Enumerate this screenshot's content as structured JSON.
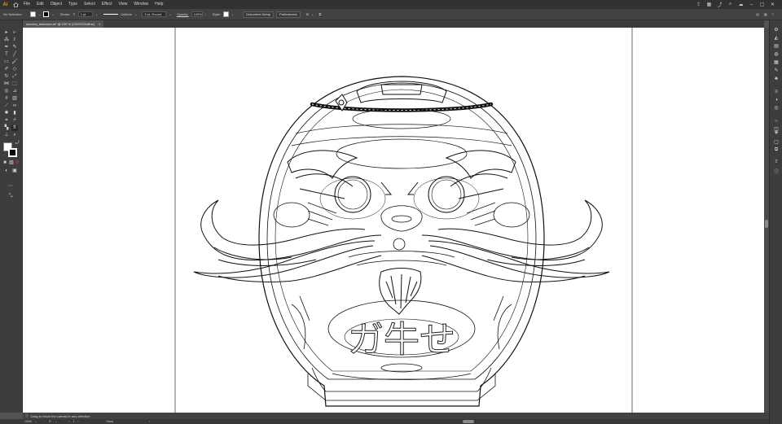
{
  "menubar": {
    "logo": "Ai",
    "items": [
      "File",
      "Edit",
      "Object",
      "Type",
      "Select",
      "Effect",
      "View",
      "Window",
      "Help"
    ]
  },
  "controlbar": {
    "selection": "No Selection",
    "stroke_label": "Stroke:",
    "stroke_weight": "1 pt",
    "stroke_profile": "Uniform",
    "brush": "5 pt. Round",
    "opacity_label": "Opacity:",
    "opacity_value": "100%",
    "style_label": "Style:",
    "document_setup": "Document Setup",
    "preferences": "Preferences"
  },
  "tab": {
    "title": "daruma_basicolor.ai* @ 100 % (CMYK/Outline)",
    "close": "×"
  },
  "status": {
    "message": "Drag to move the canvas in any direction"
  },
  "bottom": {
    "zoom": "100%",
    "rotation": "0°",
    "artboard": "1",
    "tool": "Hand"
  },
  "artwork": {
    "glyphs": "ガ牛せ"
  },
  "colors": {
    "menubar_bg": "#323232",
    "panel_bg": "#3d3d3d",
    "workspace_bg": "#535353",
    "canvas_bg": "#ffffff",
    "accent": "#ff9a00"
  }
}
